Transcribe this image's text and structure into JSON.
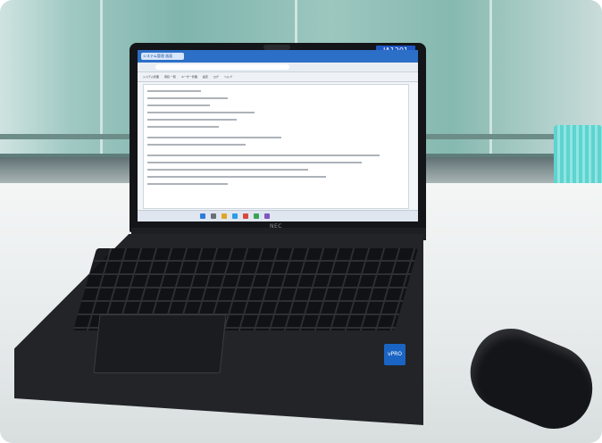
{
  "photo": {
    "screen_label": "JA1201",
    "laptop_brand": "NEC",
    "sticker_text": "vPRO",
    "browser_tab": "システム管理 画面",
    "menu": [
      "システム管理",
      "項目 一覧",
      "ユーザー管理",
      "設定",
      "ログ",
      "ヘルプ"
    ],
    "colors": {
      "wall": "#8fc2ba",
      "desk": "#eef1f1",
      "laptop": "#1e1f22",
      "screen_titlebar": "#2b6fc7",
      "label_tag": "#1f57c3"
    }
  }
}
